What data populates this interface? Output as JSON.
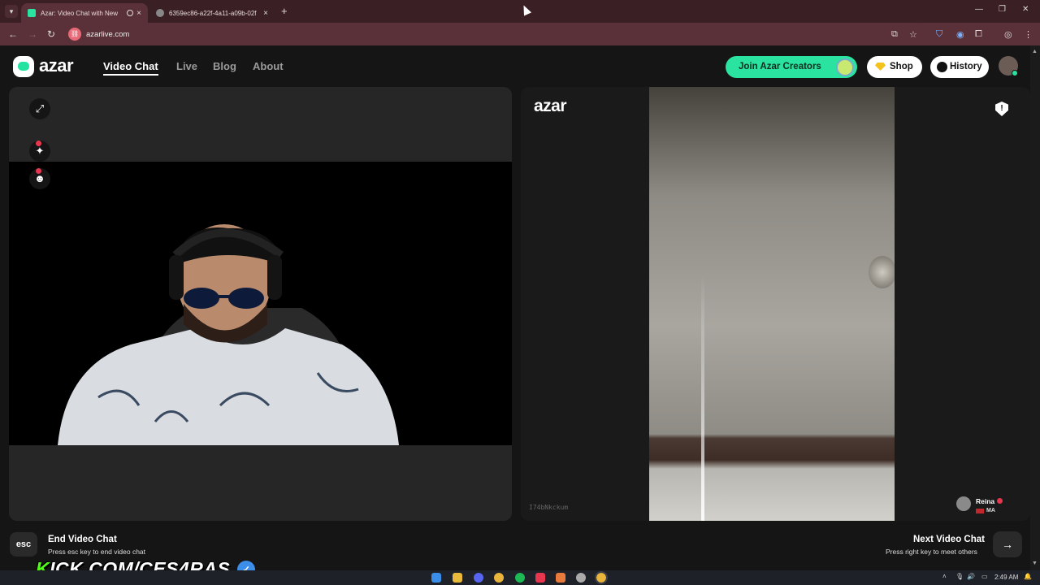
{
  "browser": {
    "tabs": [
      {
        "title": "Azar: Video Chat with New",
        "active": true
      },
      {
        "title": "6359ec86-a22f-4a11-a09b-02f",
        "active": false
      }
    ],
    "new_tab": "+",
    "window_controls": {
      "minimize": "—",
      "maximize": "❐",
      "close": "✕"
    },
    "url": "azarlive.com"
  },
  "header": {
    "logo": "azar",
    "nav": [
      "Video Chat",
      "Live",
      "Blog",
      "About"
    ],
    "active_nav": "Video Chat",
    "join_creators": "Join Azar Creators",
    "shop": "Shop",
    "history": "History"
  },
  "left_panel": {
    "icons": [
      "expand-icon",
      "sparkle-effects-icon",
      "emoji-mask-icon"
    ]
  },
  "right_panel": {
    "logo": "azar",
    "session_id": "I74bNkckum",
    "peer": {
      "name": "Reina",
      "country": "MA"
    }
  },
  "bottom": {
    "esc_key": "esc",
    "end_title": "End Video Chat",
    "end_sub": "Press esc key to end video chat",
    "next_title": "Next Video Chat",
    "next_sub": "Press right key to meet others",
    "next_arrow": "→"
  },
  "overlay": {
    "kick_prefix": "K",
    "kick_rest": "ICK.COM/CES4RAS",
    "badge": "✓"
  },
  "taskbar": {
    "time": "2:49 AM"
  },
  "colors": {
    "brand": "#2ae3a0",
    "browser_frame": "#3a1f25",
    "accent_red": "#e8364f",
    "kick_green": "#53fc18"
  }
}
